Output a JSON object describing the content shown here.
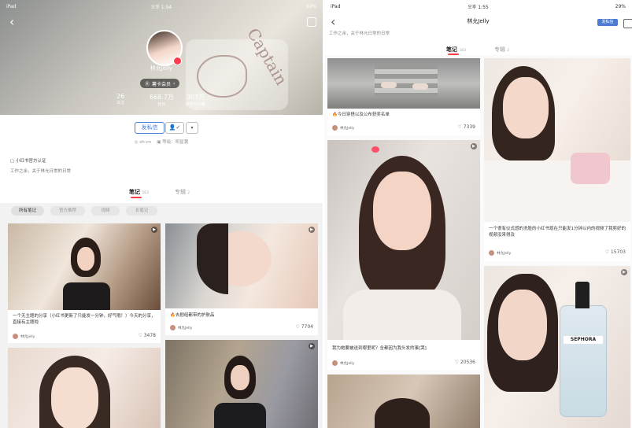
{
  "left": {
    "status": {
      "left": "iPad",
      "time": "오후 1:54",
      "battery": "30%"
    },
    "profile": {
      "username": "林允Jelly",
      "member_label": "薯卡会员",
      "stats": [
        {
          "value": "26",
          "label": "关注"
        },
        {
          "value": "668.7万",
          "label": "粉丝"
        },
        {
          "value": "303万",
          "label": "获赞与收藏"
        }
      ],
      "message_button": "发私信",
      "location": "zh-cn",
      "level": "等级：明星薯",
      "verified": "小红书官方认证",
      "bio": "工作之余，关于林允日常的日常"
    },
    "tabs": [
      {
        "label": "笔记",
        "count": "163"
      },
      {
        "label": "专辑",
        "count": "2"
      }
    ],
    "filters": [
      "所有笔记",
      "官方推荐",
      "视频",
      "长笔记"
    ],
    "cards": [
      {
        "title": "一个无主题的分享（小红书更新了只能发一分钟，好气哦！）今天的分享，直接有主题啦",
        "author": "林允Jelly",
        "likes": "3478"
      },
      {
        "title": "🔥去剧组都带的护肤品",
        "author": "林允Jelly",
        "likes": "7704"
      }
    ]
  },
  "right": {
    "status": {
      "left": "iPad",
      "time": "오후 1:55",
      "battery": "29%"
    },
    "title": "林允Jelly",
    "message_button": "发私信",
    "bio": "工作之余，关于林允日常的日常",
    "tabs": [
      {
        "label": "笔记",
        "count": "163"
      },
      {
        "label": "专辑",
        "count": "2"
      }
    ],
    "cards": [
      {
        "title": "🔥今日穿搭以及公布获奖名单",
        "author": "林允Jelly",
        "likes": "7339"
      },
      {
        "title": "一个很有仪式感的洗脸的小红书现在只能发1分钟以内的视频了我剪好的视频没来得及",
        "author": "林允Jelly",
        "likes": "15703"
      },
      {
        "title": "我为她要被送到哪里呢？全都因为我头发的事[哭]",
        "author": "林允Jelly",
        "likes": "20536"
      },
      {
        "title": "SEPHORA",
        "author": "",
        "likes": ""
      }
    ]
  }
}
